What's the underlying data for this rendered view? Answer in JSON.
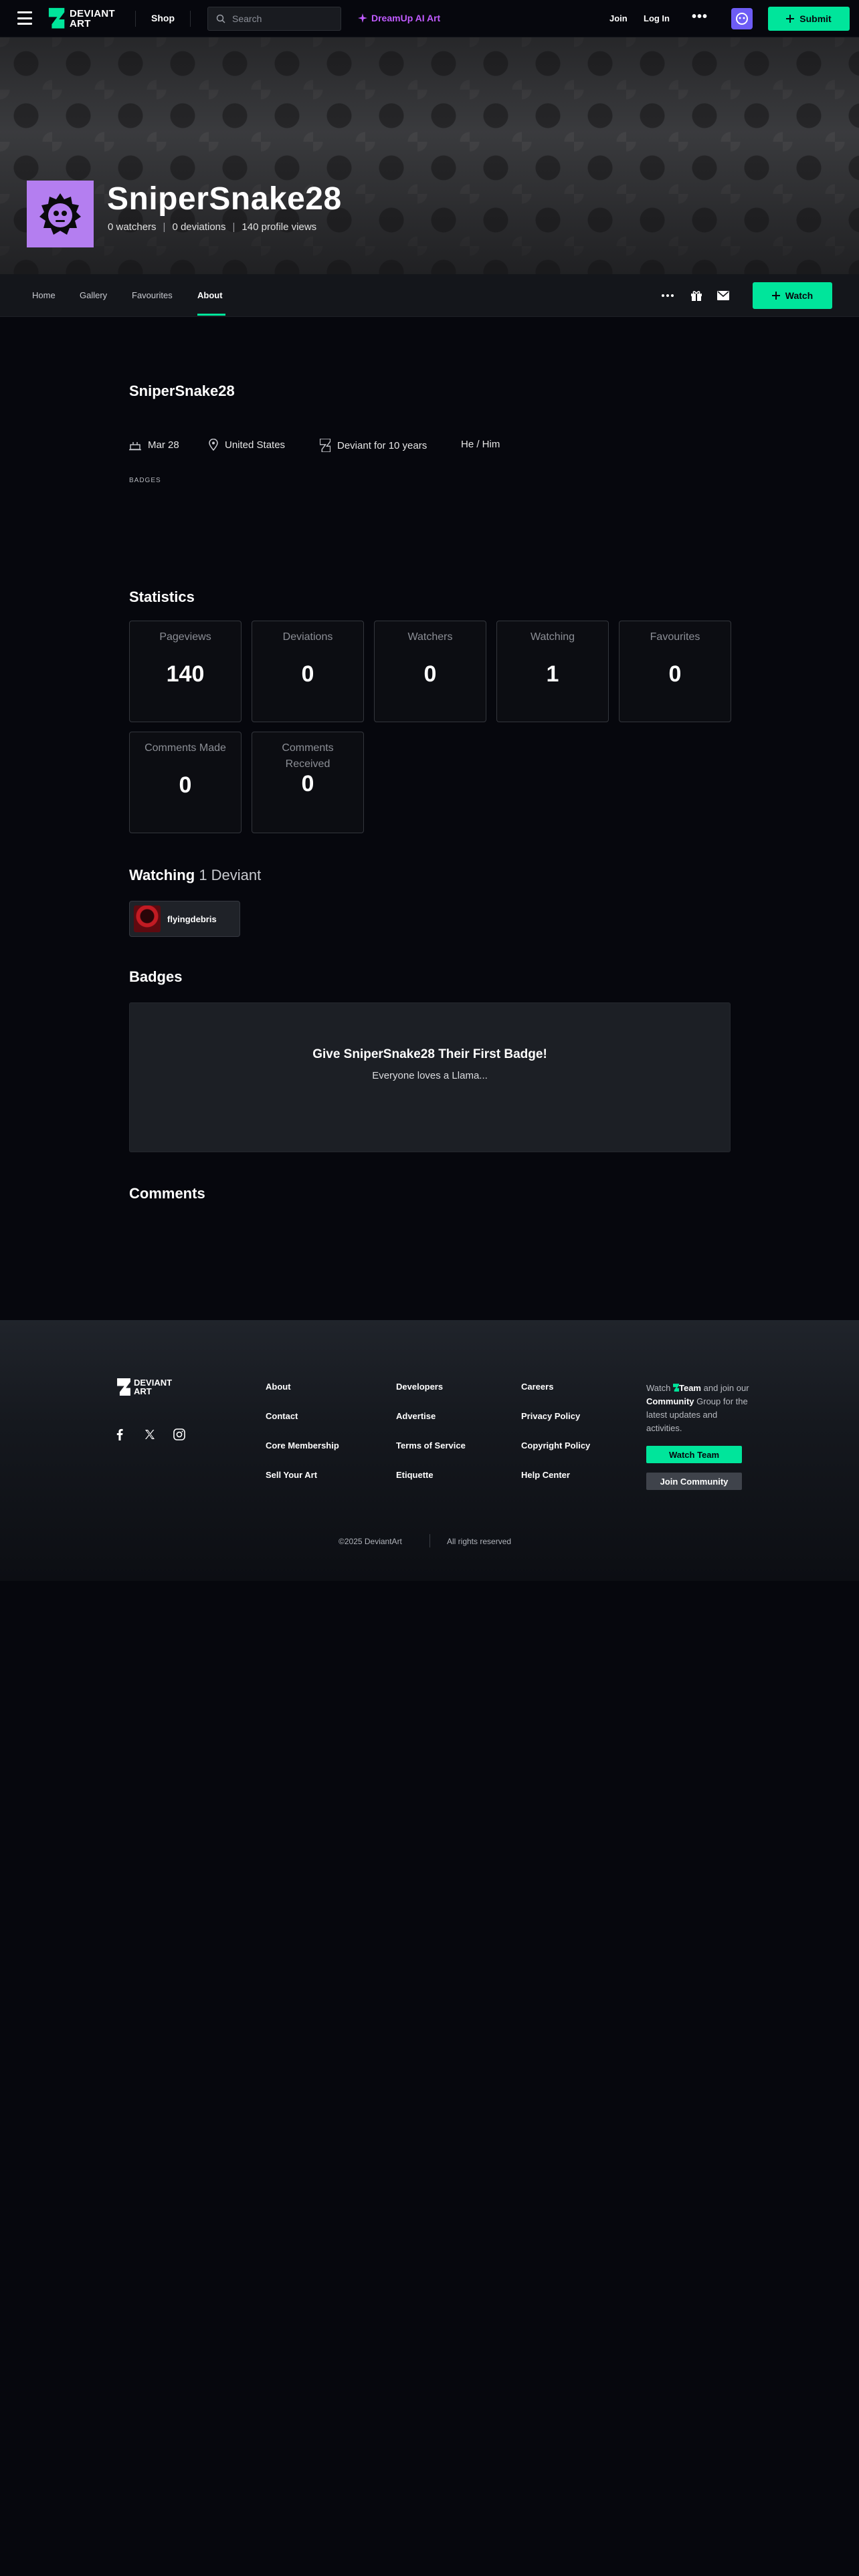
{
  "header": {
    "logo_line1": "DEVIANT",
    "logo_line2": "ART",
    "shop": "Shop",
    "search_placeholder": "Search",
    "dreamup": "DreamUp AI Art",
    "join": "Join",
    "login": "Log In",
    "more": "•••",
    "submit": "Submit"
  },
  "profile": {
    "username": "SniperSnake28",
    "watchers": "0 watchers",
    "deviations": "0 deviations",
    "views": "140 profile views",
    "avatar_color": "#b47ef0"
  },
  "subnav": {
    "tabs": [
      "Home",
      "Gallery",
      "Favourites",
      "About"
    ],
    "active_tab": "About",
    "watch": "Watch"
  },
  "about": {
    "name": "SniperSnake28",
    "birthday": "Mar 28",
    "country": "United States",
    "member": "Deviant for 10 years",
    "pronouns": "He / Him",
    "badges_label": "BADGES"
  },
  "statistics": {
    "title": "Statistics",
    "items": [
      {
        "label": "Pageviews",
        "value": "140"
      },
      {
        "label": "Deviations",
        "value": "0"
      },
      {
        "label": "Watchers",
        "value": "0"
      },
      {
        "label": "Watching",
        "value": "1"
      },
      {
        "label": "Favourites",
        "value": "0"
      },
      {
        "label": "Comments Made",
        "value": "0"
      },
      {
        "label": "Comments Received",
        "value": "0"
      }
    ]
  },
  "watching": {
    "title": "Watching",
    "count": "1 Deviant",
    "deviant_name": "flyingdebris"
  },
  "badges": {
    "title": "Badges",
    "headline": "Give SniperSnake28 Their First Badge!",
    "sub": "Everyone loves a Llama..."
  },
  "comments": {
    "title": "Comments"
  },
  "footer": {
    "col1": [
      "About",
      "Contact",
      "Core Membership",
      "Sell Your Art"
    ],
    "col2": [
      "Developers",
      "Advertise",
      "Terms of Service",
      "Etiquette"
    ],
    "col3": [
      "Careers",
      "Privacy Policy",
      "Copyright Policy",
      "Help Center"
    ],
    "cta_watch": "Watch",
    "cta_team": "Team",
    "cta_join": "and join our",
    "cta_community": "Community",
    "cta_rest": "Group for the latest updates and activities.",
    "watch_team": "Watch Team",
    "join_community": "Join Community",
    "copyright": "©2025 DeviantArt",
    "rights": "All rights reserved"
  },
  "colors": {
    "accent": "#00e59b",
    "dreamup": "#c05bff",
    "background": "#06070d"
  }
}
